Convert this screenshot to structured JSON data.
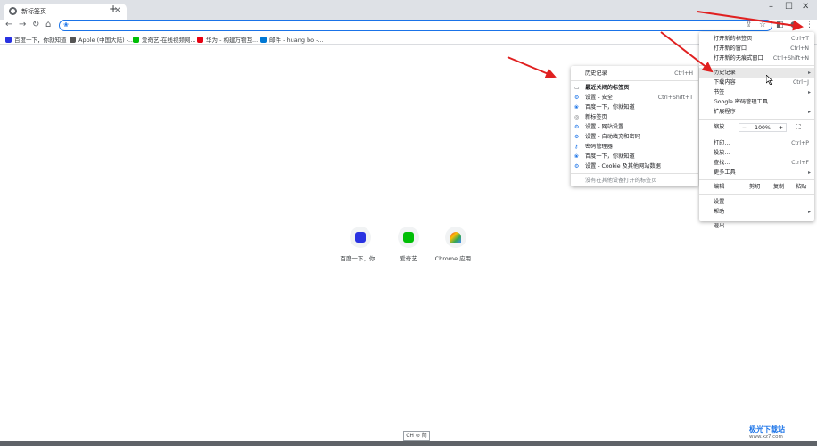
{
  "tab": {
    "title": "新标签页",
    "close": "×",
    "new_tab": "+"
  },
  "window_controls": {
    "minimize": "–",
    "maximize": "☐",
    "close": "✕"
  },
  "toolbar": {
    "back": "←",
    "forward": "→",
    "reload": "↻",
    "home": "⌂"
  },
  "omnibox": {
    "value": ""
  },
  "bookmarks": [
    {
      "label": "百度一下，你就知道",
      "color": "#2932e1"
    },
    {
      "label": "Apple (中国大陆) -...",
      "color": "#555555"
    },
    {
      "label": "爱奇艺-在线视频网...",
      "color": "#00be06"
    },
    {
      "label": "华为 - 构建万物互...",
      "color": "#e60012"
    },
    {
      "label": "邮件 - huang bo -...",
      "color": "#0078d4"
    }
  ],
  "shortcuts": [
    {
      "label": "百度一下，你...",
      "color": "#2932e1"
    },
    {
      "label": "爱奇艺",
      "color": "#00be06"
    },
    {
      "label": "Chrome 应用...",
      "color": "#ea4335"
    }
  ],
  "main_menu": {
    "new_tab": {
      "label": "打开新的标签页",
      "shortcut": "Ctrl+T"
    },
    "new_window": {
      "label": "打开新的窗口",
      "shortcut": "Ctrl+N"
    },
    "incognito": {
      "label": "打开新的无痕式窗口",
      "shortcut": "Ctrl+Shift+N"
    },
    "history": {
      "label": "历史记录"
    },
    "downloads": {
      "label": "下载内容",
      "shortcut": "Ctrl+J"
    },
    "bookmarks": {
      "label": "书签"
    },
    "password_manager": {
      "label": "Google 密码管理工具"
    },
    "extensions": {
      "label": "扩展程序"
    },
    "zoom": {
      "label": "缩放",
      "minus": "−",
      "value": "100%",
      "plus": "+",
      "fullscreen": "⛶"
    },
    "print": {
      "label": "打印...",
      "shortcut": "Ctrl+P"
    },
    "cast": {
      "label": "投放..."
    },
    "find": {
      "label": "查找...",
      "shortcut": "Ctrl+F"
    },
    "more_tools": {
      "label": "更多工具"
    },
    "edit": {
      "label": "编辑",
      "cut": "剪切",
      "copy": "复制",
      "paste": "粘贴"
    },
    "settings": {
      "label": "设置"
    },
    "help": {
      "label": "帮助"
    },
    "exit": {
      "label": "退出"
    }
  },
  "history_menu": {
    "header": {
      "label": "历史记录",
      "shortcut": "Ctrl+H"
    },
    "recently_closed_title": "最近关闭的标签页",
    "items": [
      {
        "label": "设置 - 安全",
        "shortcut": "Ctrl+Shift+T",
        "icon": "gear-icon"
      },
      {
        "label": "百度一下，你就知道",
        "shortcut": "",
        "icon": "baidu-icon"
      },
      {
        "label": "新标签页",
        "shortcut": "",
        "icon": "chrome-icon"
      },
      {
        "label": "设置 - 网站设置",
        "shortcut": "",
        "icon": "gear-icon"
      },
      {
        "label": "设置 - 自动填充和密码",
        "shortcut": "",
        "icon": "gear-icon"
      },
      {
        "label": "密码管理器",
        "shortcut": "",
        "icon": "key-icon"
      },
      {
        "label": "百度一下，你就知道",
        "shortcut": "",
        "icon": "baidu-icon"
      },
      {
        "label": "设置 - Cookie 及其他网站数据",
        "shortcut": "",
        "icon": "gear-icon"
      }
    ],
    "other_devices": "没有在其他设备打开的标签页"
  },
  "ime": "CH ⊘ 简",
  "watermark": {
    "title": "极光下载站",
    "url": "www.xz7.com"
  },
  "colors": {
    "accent": "#1a73e8",
    "arrow": "#e02020"
  }
}
